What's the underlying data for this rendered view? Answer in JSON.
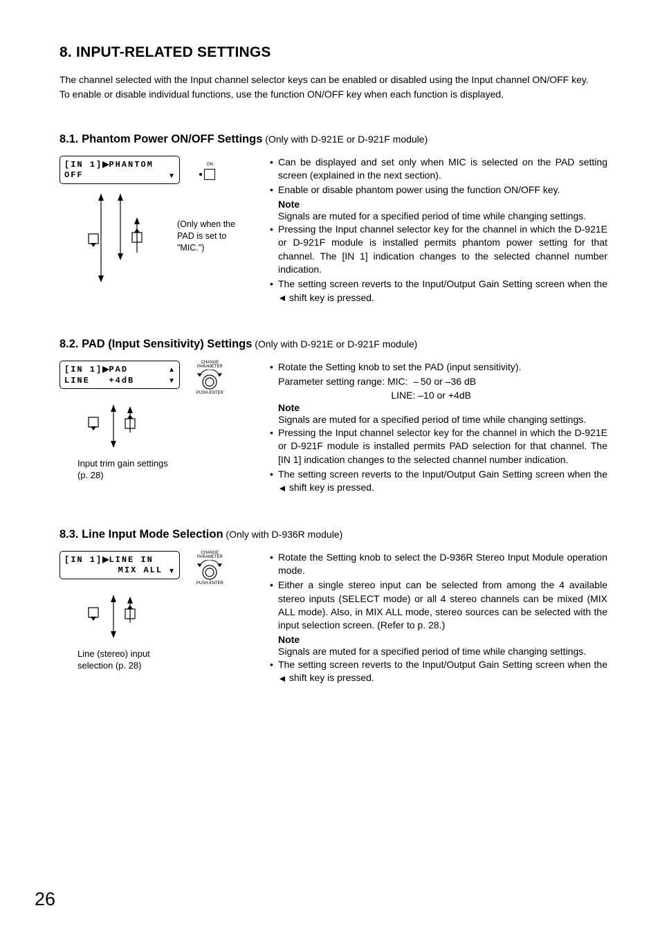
{
  "page_number": "26",
  "title": "8. INPUT-RELATED SETTINGS",
  "intro": {
    "p1": "The channel selected with the Input channel selector keys can be enabled or disabled using the Input channel ON/OFF key.",
    "p2": "To enable or disable individual functions, use the function ON/OFF key when each function is displayed."
  },
  "s81": {
    "heading": "8.1. Phantom Power ON/OFF Settings",
    "heading_suffix": " (Only with D-921E or D-921F module)",
    "lcd_line1_left": "[IN 1]",
    "lcd_line1_right": "PHANTOM",
    "lcd_line2_left": "OFF",
    "on_label": "ON",
    "nav_note_l1": "(Only when the",
    "nav_note_l2": "PAD is set to",
    "nav_note_l3": "\"MIC.\")",
    "b1": "Can be displayed and set only when MIC is selected on the PAD setting screen (explained in the next section).",
    "b2": "Enable or disable phantom power using the function ON/OFF key.",
    "note_label": "Note",
    "note_text": "Signals are muted for a specified period of time while changing settings.",
    "b3": "Pressing the Input channel selector key for the channel in which the D-921E or D-921F module is installed permits phantom power setting for that channel. The [IN 1] indication changes to the selected channel number indication.",
    "b4_a": "The setting screen reverts to the Input/Output Gain Setting screen when the ",
    "b4_b": " shift key is pressed."
  },
  "s82": {
    "heading": "8.2. PAD (Input Sensitivity) Settings",
    "heading_suffix": " (Only with D-921E or D-921F module)",
    "lcd_line1_left": "[IN 1]",
    "lcd_line1_right": "PAD",
    "lcd_line2_left": "LINE",
    "lcd_line2_right": "+4dB",
    "knob_t1": "CHANGE",
    "knob_t2": "PARAMETER",
    "knob_t3": "PUSH-ENTER",
    "caption_l1": "Input trim gain settings",
    "caption_l2": "(p. 28)",
    "b1": "Rotate the Setting knob to set the PAD (input sensitivity).",
    "sub1": "Parameter setting range: MIC:  – 50 or –36 dB",
    "sub2": "                                          LINE: –10 or +4dB",
    "note_label": "Note",
    "note_text": "Signals are muted for a specified period of time while changing settings.",
    "b2": "Pressing the Input channel selector key for the channel in which the D-921E or D-921F module is installed permits PAD selection for that channel. The [IN 1] indication changes to the selected channel number indication.",
    "b3_a": "The setting screen reverts to the Input/Output Gain Setting screen when the ",
    "b3_b": " shift key is pressed."
  },
  "s83": {
    "heading": "8.3. Line Input Mode Selection",
    "heading_suffix": " (Only with D-936R module)",
    "lcd_line1_left": "[IN 1]",
    "lcd_line1_right": "LINE IN",
    "lcd_line2_right": "MIX ALL",
    "knob_t1": "CHANGE",
    "knob_t2": "PARAMETER",
    "knob_t3": "PUSH-ENTER",
    "caption_l1": "Line (stereo) input",
    "caption_l2": "selection (p. 28)",
    "b1": "Rotate the Setting knob to select the D-936R Stereo Input Module operation mode.",
    "b2": "Either a single stereo input can be selected from among the 4 available stereo inputs (SELECT mode) or all 4 stereo channels can be mixed (MIX ALL mode). Also, in MIX ALL mode, stereo sources can be selected with the input selection screen. (Refer to p. 28.)",
    "note_label": "Note",
    "note_text": "Signals are muted for a specified period of time while changing settings.",
    "b3_a": "The setting screen reverts to the Input/Output Gain Setting screen when the ",
    "b3_b": " shift key is pressed."
  }
}
